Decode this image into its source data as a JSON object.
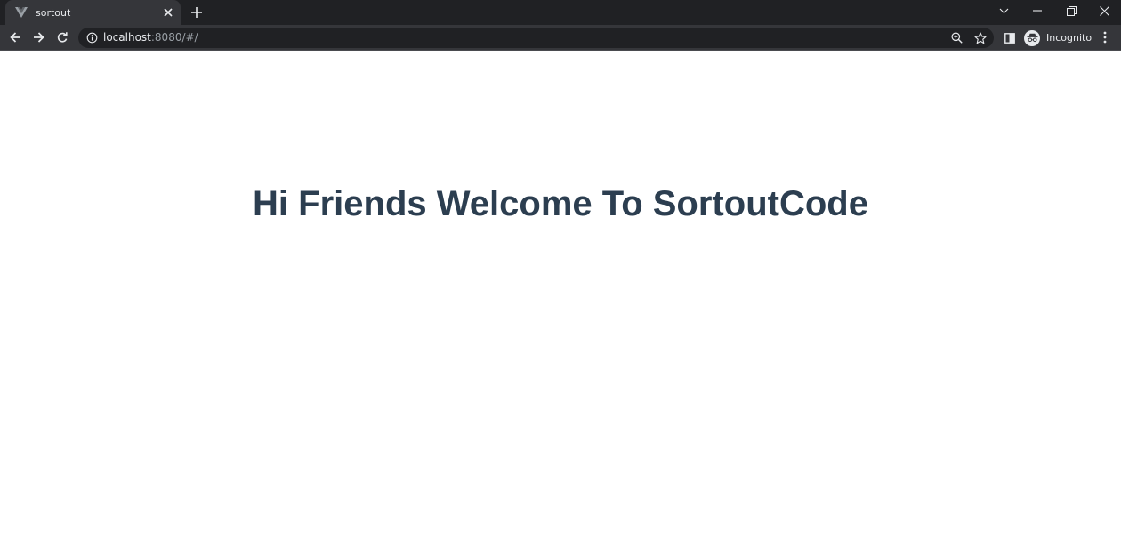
{
  "browser": {
    "tab": {
      "title": "sortout"
    },
    "address": {
      "host": "localhost",
      "rest": ":8080/#/"
    },
    "profile": {
      "label": "Incognito"
    }
  },
  "page": {
    "heading": "Hi Friends Welcome To SortoutCode",
    "heading_color": "#2c3e50"
  },
  "icons": [
    "vue-favicon-icon",
    "close-icon",
    "plus-icon",
    "chevron-down-icon",
    "minimize-icon",
    "restore-icon",
    "close-window-icon",
    "back-arrow-icon",
    "forward-arrow-icon",
    "reload-icon",
    "info-icon",
    "zoom-icon",
    "star-icon",
    "side-panel-icon",
    "incognito-icon",
    "kebab-menu-icon"
  ]
}
